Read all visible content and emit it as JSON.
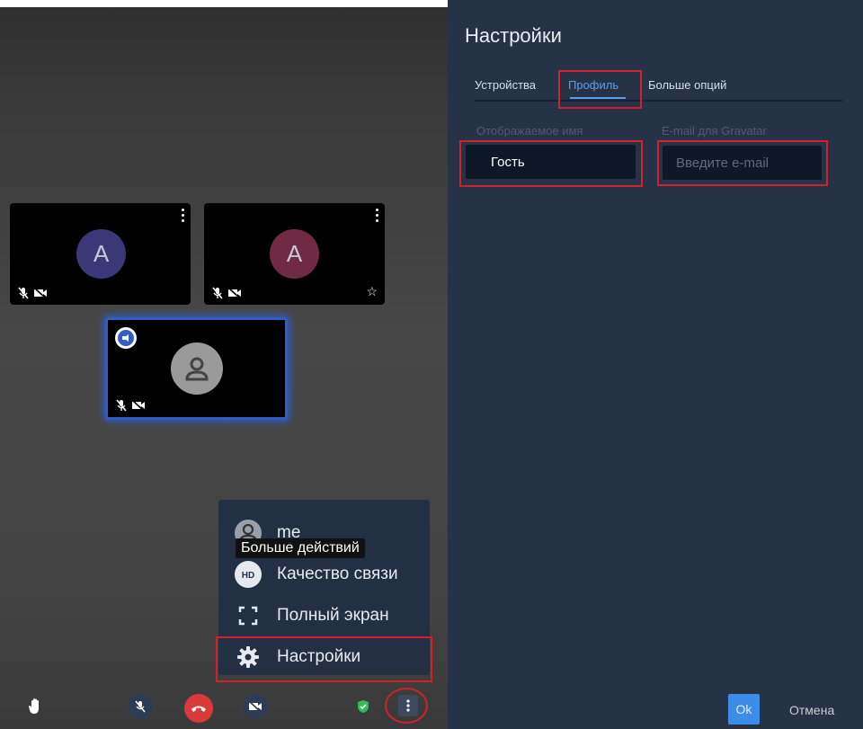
{
  "conference": {
    "participants": [
      {
        "initial": "A",
        "color": "#3b3878"
      },
      {
        "initial": "A",
        "color": "#6e2b43"
      }
    ],
    "menu": {
      "items": [
        {
          "label": "me",
          "icon": "user-avatar-icon"
        },
        {
          "label": "Качество связи",
          "icon": "hd-icon"
        },
        {
          "label": "Полный экран",
          "icon": "fullscreen-icon"
        },
        {
          "label": "Настройки",
          "icon": "gear-icon"
        }
      ]
    },
    "tooltip": "Больше действий",
    "toolbar": {
      "icons": [
        "raise-hand-icon",
        "mic-off-icon",
        "hangup-icon",
        "camera-off-icon",
        "security-shield-icon",
        "more-actions-icon"
      ],
      "hangup_color": "#d93a3a"
    }
  },
  "settings": {
    "title": "Настройки",
    "tabs": [
      {
        "label": "Устройства"
      },
      {
        "label": "Профиль",
        "active": true
      },
      {
        "label": "Больше опций"
      }
    ],
    "display_name_label": "Отображаемое имя",
    "display_name_value": "Гость",
    "email_label": "E-mail для Gravatar",
    "email_placeholder": "Введите e-mail",
    "ok_label": "Ok",
    "cancel_label": "Отмена"
  },
  "colors": {
    "panel_bg": "#263347",
    "accent": "#5a9cf0",
    "highlight": "#d4202c"
  }
}
